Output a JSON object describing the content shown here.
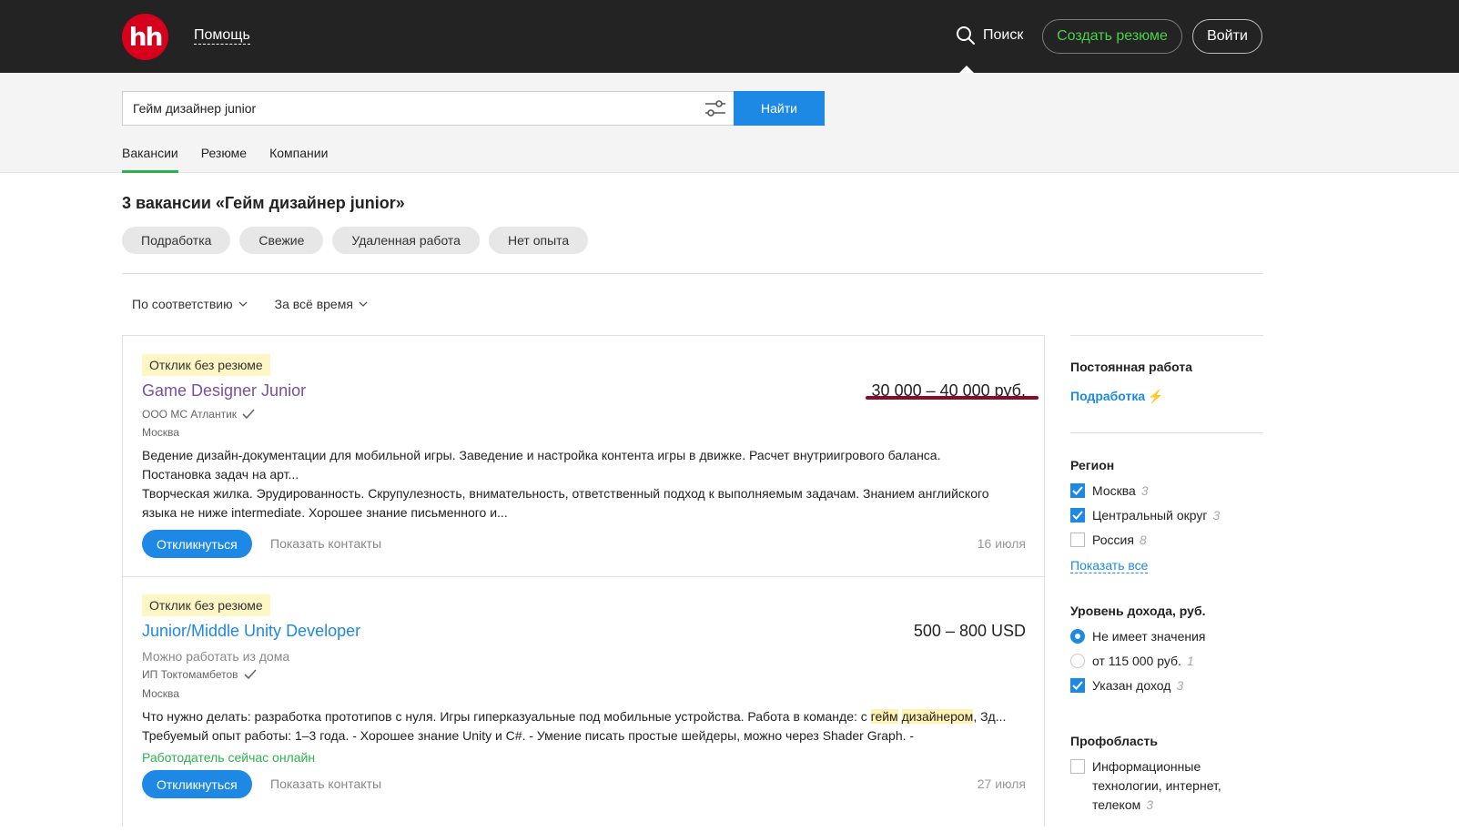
{
  "header": {
    "logo_text": "hh",
    "help_label": "Помощь",
    "search_label": "Поиск",
    "create_resume_label": "Создать резюме",
    "login_label": "Войти"
  },
  "search": {
    "query": "Гейм дизайнер junior",
    "find_label": "Найти"
  },
  "tabs": [
    "Вакансии",
    "Резюме",
    "Компании"
  ],
  "results_title": "3 вакансии «Гейм дизайнер junior»",
  "chips": [
    "Подработка",
    "Свежие",
    "Удаленная работа",
    "Нет опыта"
  ],
  "sort": {
    "order_label": "По соответствию",
    "period_label": "За всё время"
  },
  "vacancies": [
    {
      "badge": "Отклик без резюме",
      "title": "Game Designer Junior",
      "salary": "30 000 – 40 000 руб.",
      "company": "ООО МС Атлантик",
      "city": "Москва",
      "desc_line1": "Ведение дизайн-документации для мобильной игры. Заведение и настройка контента игры в движке. Расчет внутриигрового баланса.",
      "desc_line2": "Постановка задач на арт...",
      "desc_line3": "Творческая жилка. Эрудированность. Скрупулезность, внимательность, ответственный подход к выполняемым задачам. Знанием английского",
      "desc_line4": "языка не ниже intermediate. Хорошее знание письменного и...",
      "apply_label": "Откликнуться",
      "contacts_label": "Показать контакты",
      "date": "16 июля"
    },
    {
      "badge": "Отклик без резюме",
      "title": "Junior/Middle Unity Developer",
      "salary": "500 – 800 USD",
      "remote": "Можно работать из дома",
      "company": "ИП Токтомамбетов",
      "city": "Москва",
      "desc_line1_pre": "Что нужно делать: разработка прототипов с нуля. Игры гиперказуальные под мобильные устройства. Работа в команде: с ",
      "desc_hl1": "гейм",
      "desc_space": " ",
      "desc_hl2": "дизайнером",
      "desc_line1_post": ", Зд...",
      "desc_line2": "Требуемый опыт работы: 1–3 года. - Хорошее знание Unity и C#. - Умение писать простые шейдеры, можно через Shader Graph. -",
      "online": "Работодатель сейчас онлайн",
      "apply_label": "Откликнуться",
      "contacts_label": "Показать контакты",
      "date": "27 июля"
    }
  ],
  "sidebar": {
    "employment_head": "Постоянная работа",
    "employment_link": "Подработка",
    "employment_icon": "⚡",
    "region_head": "Регион",
    "regions": [
      {
        "label": "Москва",
        "count": "3",
        "checked": true
      },
      {
        "label": "Центральный округ",
        "count": "3",
        "checked": true
      },
      {
        "label": "Россия",
        "count": "8",
        "checked": false
      }
    ],
    "show_all": "Показать все",
    "income_head": "Уровень дохода, руб.",
    "income_opts": [
      {
        "label": "Не имеет значения",
        "count": ""
      },
      {
        "label": "от 115 000 руб.",
        "count": "1"
      },
      {
        "label": "Указан доход",
        "count": "3"
      }
    ],
    "prof_head": "Профобласть",
    "prof_line1": "Информационные",
    "prof_line2": "технологии, интернет,",
    "prof_line3": "телеком",
    "prof_count": "3"
  },
  "colors": {
    "brand_red": "#d6001c",
    "accent_blue": "#1e88e5",
    "accent_green": "#2bb24c",
    "badge_yellow": "#fff6c6"
  }
}
